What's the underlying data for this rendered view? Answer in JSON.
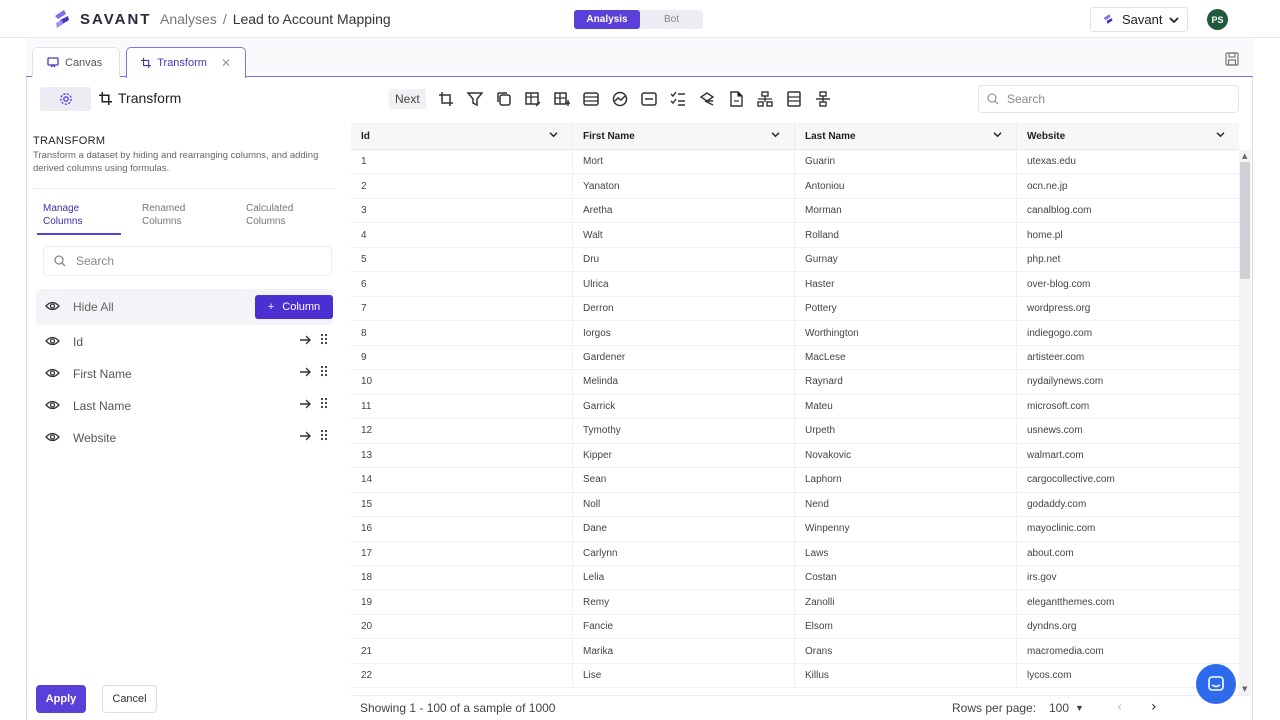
{
  "brand": {
    "name": "SAVANT",
    "accent": "#5a3fd8"
  },
  "breadcrumb": {
    "root": "Analyses",
    "separator": "/",
    "current": "Lead to Account Mapping"
  },
  "mode_toggle": {
    "options": [
      "Analysis",
      "Bot"
    ],
    "selected": "Analysis"
  },
  "workspace": {
    "name": "Savant"
  },
  "user": {
    "initials": "PS"
  },
  "tabs": [
    {
      "label": "Canvas",
      "icon": "canvas-icon"
    },
    {
      "label": "Transform",
      "icon": "crop-icon",
      "active": true
    }
  ],
  "toolbar": {
    "title": "Transform",
    "next_label": "Next",
    "search_placeholder": "Search",
    "icons": [
      "crop-icon",
      "filter-icon",
      "copy-icon",
      "table-edit-icon",
      "table-add-icon",
      "rows-icon",
      "chart-icon",
      "minus-box-icon",
      "checklist-icon",
      "shapes-icon",
      "file-icon",
      "split-icon",
      "columns-icon",
      "hierarchy-icon"
    ]
  },
  "left_panel": {
    "title": "TRANSFORM",
    "description": "Transform a dataset by hiding and rearranging columns, and adding derived columns using formulas.",
    "subtabs": [
      {
        "line1": "Manage",
        "line2": "Columns",
        "active": true
      },
      {
        "line1": "Renamed",
        "line2": "Columns"
      },
      {
        "line1": "Calculated",
        "line2": "Columns"
      }
    ],
    "search_placeholder": "Search",
    "hide_all_label": "Hide All",
    "add_column_label": "Column",
    "columns": [
      "Id",
      "First Name",
      "Last Name",
      "Website"
    ],
    "apply_label": "Apply",
    "cancel_label": "Cancel"
  },
  "grid": {
    "headers": [
      "Id",
      "First Name",
      "Last Name",
      "Website"
    ],
    "rows": [
      [
        "1",
        "Mort",
        "Guarin",
        "utexas.edu"
      ],
      [
        "2",
        "Yanaton",
        "Antoniou",
        "ocn.ne.jp"
      ],
      [
        "3",
        "Aretha",
        "Morman",
        "canalblog.com"
      ],
      [
        "4",
        "Walt",
        "Rolland",
        "home.pl"
      ],
      [
        "5",
        "Dru",
        "Gurnay",
        "php.net"
      ],
      [
        "6",
        "Ulrica",
        "Haster",
        "over-blog.com"
      ],
      [
        "7",
        "Derron",
        "Pottery",
        "wordpress.org"
      ],
      [
        "8",
        "Iorgos",
        "Worthington",
        "indiegogo.com"
      ],
      [
        "9",
        "Gardener",
        "MacLese",
        "artisteer.com"
      ],
      [
        "10",
        "Melinda",
        "Raynard",
        "nydailynews.com"
      ],
      [
        "11",
        "Garrick",
        "Mateu",
        "microsoft.com"
      ],
      [
        "12",
        "Tymothy",
        "Urpeth",
        "usnews.com"
      ],
      [
        "13",
        "Kipper",
        "Novakovic",
        "walmart.com"
      ],
      [
        "14",
        "Sean",
        "Laphorn",
        "cargocollective.com"
      ],
      [
        "15",
        "Noll",
        "Nend",
        "godaddy.com"
      ],
      [
        "16",
        "Dane",
        "Winpenny",
        "mayoclinic.com"
      ],
      [
        "17",
        "Carlynn",
        "Laws",
        "about.com"
      ],
      [
        "18",
        "Lelia",
        "Costan",
        "irs.gov"
      ],
      [
        "19",
        "Remy",
        "Zanolli",
        "elegantthemes.com"
      ],
      [
        "20",
        "Fancie",
        "Elsom",
        "dyndns.org"
      ],
      [
        "21",
        "Marika",
        "Orans",
        "macromedia.com"
      ],
      [
        "22",
        "Lise",
        "Killus",
        "lycos.com"
      ]
    ]
  },
  "footer": {
    "status": "Showing 1 - 100 of a sample of 1000",
    "rows_per_page_label": "Rows per page:",
    "rows_per_page_value": "100"
  }
}
